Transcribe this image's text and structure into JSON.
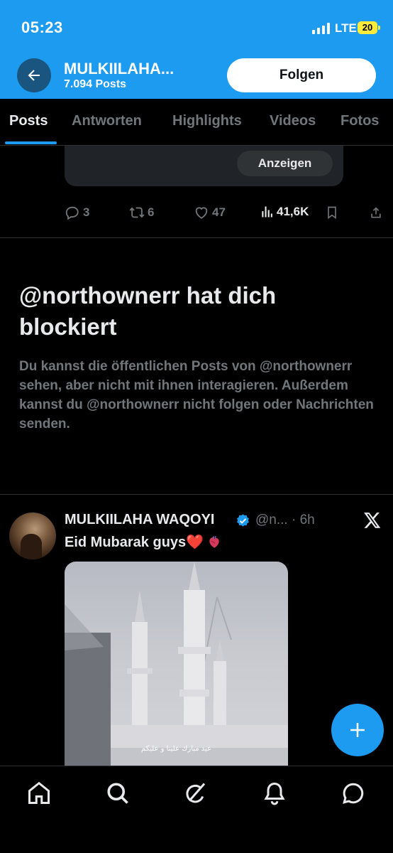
{
  "status_bar": {
    "time": "05:23",
    "network": "LTE",
    "battery": "20"
  },
  "header": {
    "title": "MULKIILAHA...",
    "post_count": "7.094 Posts",
    "follow_label": "Folgen",
    "back_icon": "arrow-left-icon"
  },
  "tabs": [
    {
      "label": "Posts",
      "active": true
    },
    {
      "label": "Antworten"
    },
    {
      "label": "Highlights"
    },
    {
      "label": "Videos"
    },
    {
      "label": "Fotos"
    }
  ],
  "prev_post": {
    "show_label": "Anzeigen",
    "replies": "3",
    "reposts": "6",
    "likes": "47",
    "views": "41,6K"
  },
  "blocked": {
    "title": "@northownerr hat dich blockiert",
    "text": "Du kannst die öffentlichen Posts von @northownerr sehen, aber nicht mit ihnen interagieren. Außerdem kannst du @northownerr nicht folgen oder Nachrichten senden."
  },
  "tweet": {
    "author": "MULKIILAHA WAQOYI",
    "handle": "@n... · 6h",
    "text": "Eid Mubarak guys❤️",
    "image_caption": "عيد مبارك علينا و عليكم"
  },
  "colors": {
    "accent": "#1d9bf0",
    "background": "#000000",
    "muted": "#71767b"
  },
  "bottom_nav": [
    "home-icon",
    "search-icon",
    "grok-icon",
    "notifications-icon",
    "messages-icon"
  ]
}
